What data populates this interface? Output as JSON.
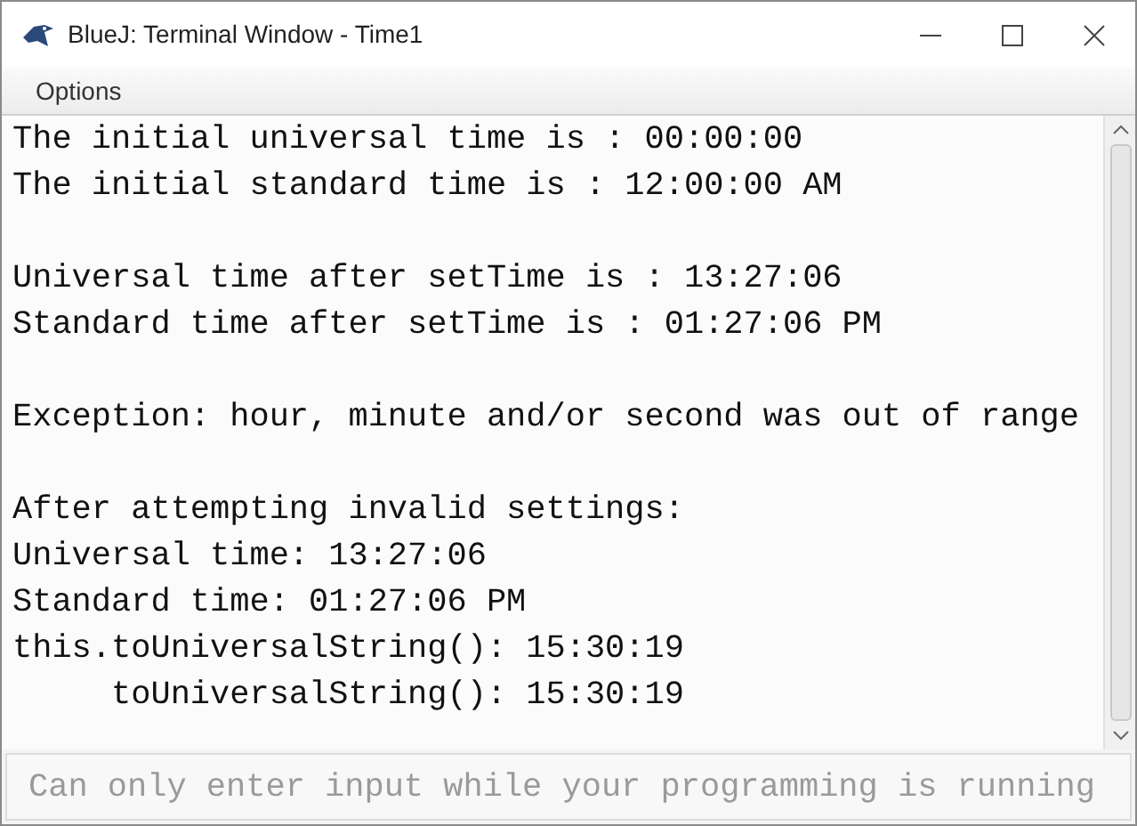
{
  "window": {
    "title": "BlueJ: Terminal Window - Time1"
  },
  "menu": [
    {
      "label": "Options"
    }
  ],
  "terminal": {
    "paragraphs": [
      [
        "The initial universal time is : 00:00:00",
        "The initial standard time is : 12:00:00 AM"
      ],
      [
        "Universal time after setTime is : 13:27:06",
        "Standard time after setTime is : 01:27:06 PM"
      ],
      [
        "Exception: hour, minute and/or second was out of range"
      ],
      [
        "After attempting invalid settings:",
        "Universal time: 13:27:06",
        "Standard time: 01:27:06 PM",
        "this.toUniversalString(): 15:30:19",
        "     toUniversalString(): 15:30:19"
      ]
    ]
  },
  "input": {
    "placeholder": "Can only enter input while your programming is running"
  }
}
